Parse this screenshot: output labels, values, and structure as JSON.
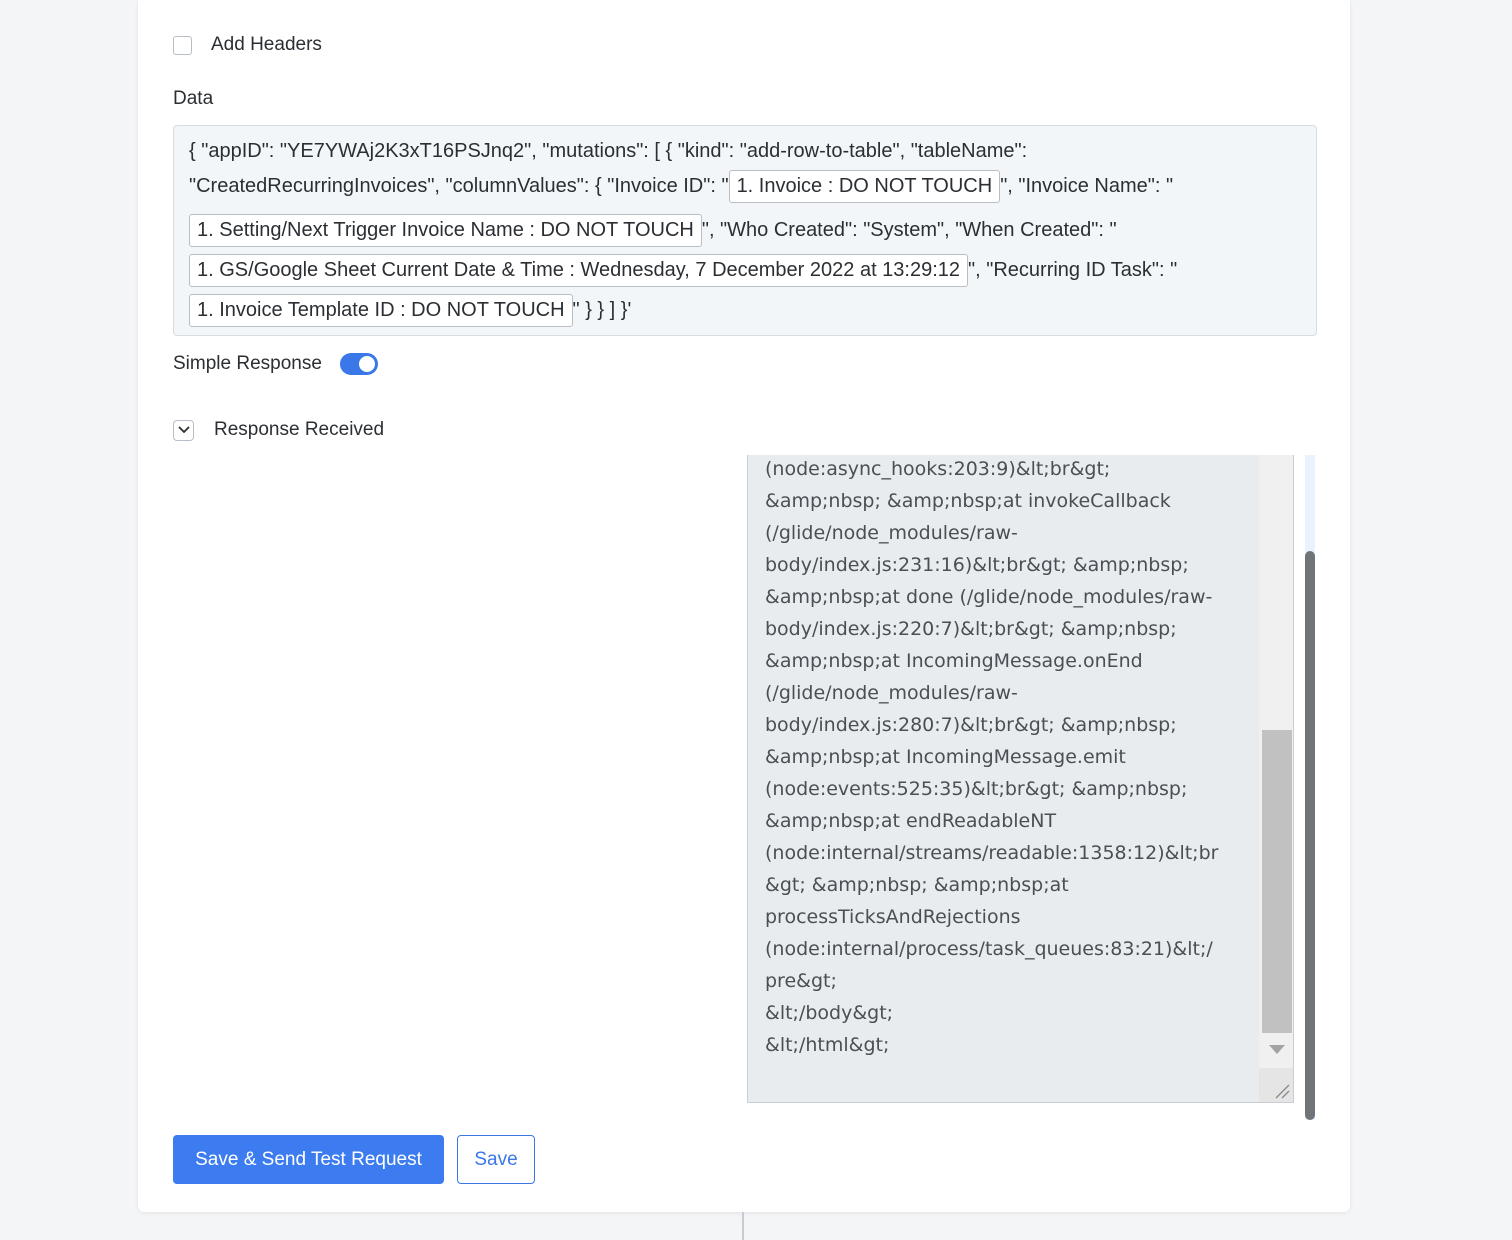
{
  "headers": {
    "label": "Add Headers",
    "checked": false
  },
  "data_section": {
    "label": "Data",
    "line1": "{ \"appID\": \"YE7YWAj2K3xT16PSJnq2\", \"mutations\": [ { \"kind\": \"add-row-to-table\", \"tableName\":",
    "line2_a": "\"CreatedRecurringInvoices\", \"columnValues\": { \"Invoice ID\": \"",
    "pill_invoice_id": "1. Invoice : DO NOT TOUCH",
    "line2_b": "\", \"Invoice Name\": \"",
    "pill_invoice_name": "1. Setting/Next Trigger Invoice Name : DO NOT TOUCH",
    "line3_b": "\", \"Who Created\": \"System\", \"When Created\": \"",
    "pill_when_created": "1. GS/Google Sheet Current Date & Time : Wednesday, 7 December 2022 at 13:29:12",
    "line4_b": "\", \"Recurring ID Task\": \"",
    "pill_recurring_id": "1. Invoice Template ID : DO NOT TOUCH",
    "line5_b": "\" } } ] }'"
  },
  "simple_response": {
    "label": "Simple Response",
    "enabled": true
  },
  "response_received": {
    "label": "Response Received",
    "lines": [
      "(node:async_hooks:203:9)&lt;br&gt;",
      "&amp;nbsp; &amp;nbsp;at invokeCallback",
      "(/glide/node_modules/raw-",
      "body/index.js:231:16)&lt;br&gt; &amp;nbsp;",
      "&amp;nbsp;at done (/glide/node_modules/raw-",
      "body/index.js:220:7)&lt;br&gt; &amp;nbsp;",
      "&amp;nbsp;at IncomingMessage.onEnd",
      "(/glide/node_modules/raw-",
      "body/index.js:280:7)&lt;br&gt; &amp;nbsp;",
      "&amp;nbsp;at IncomingMessage.emit",
      "(node:events:525:35)&lt;br&gt; &amp;nbsp;",
      "&amp;nbsp;at endReadableNT",
      "(node:internal/streams/readable:1358:12)&lt;br",
      "&gt; &amp;nbsp; &amp;nbsp;at",
      "processTicksAndRejections",
      "(node:internal/process/task_queues:83:21)&lt;/",
      "pre&gt;",
      "&lt;/body&gt;",
      "&lt;/html&gt;"
    ]
  },
  "buttons": {
    "primary": "Save & Send Test Request",
    "secondary": "Save"
  },
  "colors": {
    "accent": "#3c7cf0",
    "panel_bg": "#f3f6f9",
    "response_bg": "#e9ecef"
  },
  "icons": {
    "checkbox": "checkbox-empty-icon",
    "chevron": "chevron-down-icon"
  }
}
